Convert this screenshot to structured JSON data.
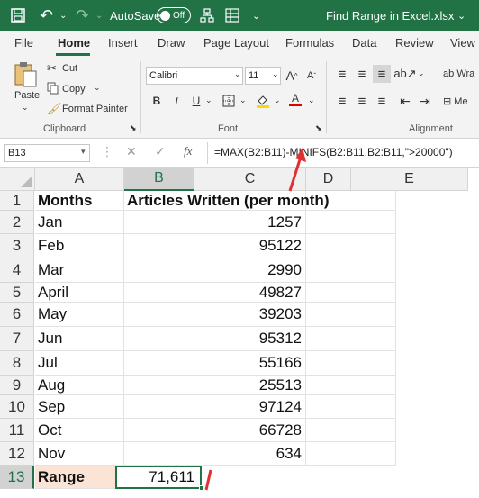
{
  "titlebar": {
    "autosave_label": "AutoSave",
    "autosave_state": "Off",
    "filename": "Find Range in Excel.xlsx",
    "filename_caret": "⌄"
  },
  "tabs": [
    "File",
    "Home",
    "Insert",
    "Draw",
    "Page Layout",
    "Formulas",
    "Data",
    "Review",
    "View"
  ],
  "ribbon": {
    "clipboard": {
      "paste": "Paste",
      "cut": "Cut",
      "copy": "Copy",
      "format_painter": "Format Painter",
      "label": "Clipboard"
    },
    "font": {
      "name": "Calibri",
      "size": "11",
      "bold": "B",
      "italic": "I",
      "underline": "U",
      "grow": "A",
      "shrink": "A",
      "font_color": "A",
      "label": "Font"
    },
    "alignment": {
      "wrap": "Wra",
      "merge": "Me",
      "label": "Alignment"
    }
  },
  "formula_bar": {
    "name_box": "B13",
    "fx": "fx",
    "formula": "=MAX(B2:B11)-MINIFS(B2:B11,B2:B11,\">20000\")"
  },
  "columns": [
    "A",
    "B",
    "C",
    "D",
    "E"
  ],
  "rows": [
    {
      "n": "1",
      "a": "Months",
      "b": "Articles Written (per month)"
    },
    {
      "n": "2",
      "a": "Jan",
      "b": "1257"
    },
    {
      "n": "3",
      "a": "Feb",
      "b": "95122"
    },
    {
      "n": "4",
      "a": "Mar",
      "b": "2990"
    },
    {
      "n": "5",
      "a": "April",
      "b": "49827"
    },
    {
      "n": "6",
      "a": "May",
      "b": "39203"
    },
    {
      "n": "7",
      "a": "Jun",
      "b": "95312"
    },
    {
      "n": "8",
      "a": "Jul",
      "b": "55166"
    },
    {
      "n": "9",
      "a": "Aug",
      "b": "25513"
    },
    {
      "n": "10",
      "a": "Sep",
      "b": "97124"
    },
    {
      "n": "11",
      "a": "Oct",
      "b": "66728"
    },
    {
      "n": "12",
      "a": "Nov",
      "b": "634"
    },
    {
      "n": "13",
      "a": "Range",
      "b": "71,611"
    }
  ],
  "colors": {
    "accent": "#217346",
    "range_fill": "#fbe4d5",
    "arrow": "#e03030"
  }
}
